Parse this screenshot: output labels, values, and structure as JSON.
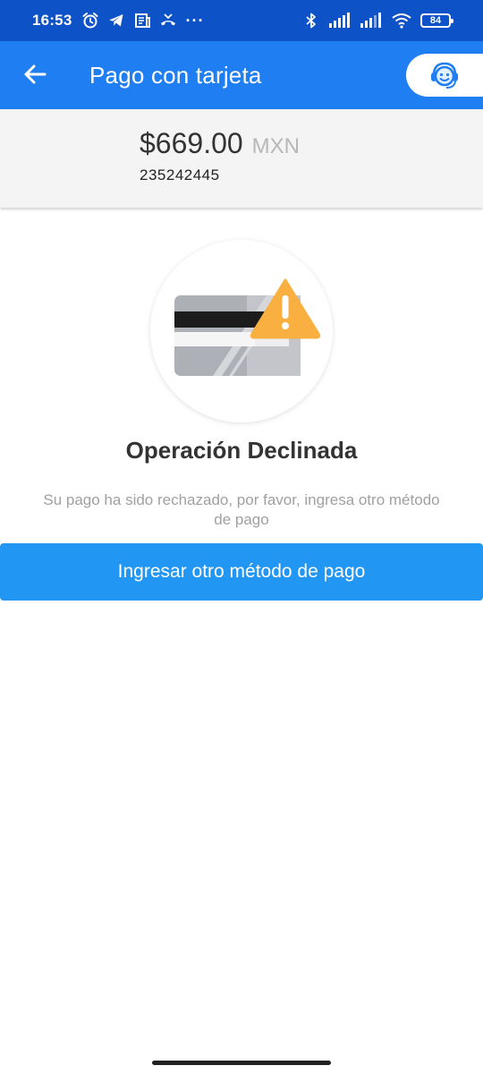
{
  "status_bar": {
    "time": "16:53",
    "more": "···",
    "battery": "84",
    "icons": [
      "alarm-icon",
      "telegram-icon",
      "news-icon",
      "missed-call-icon",
      "bluetooth-icon",
      "signal-icon",
      "signal-icon",
      "wifi-icon",
      "battery-icon"
    ]
  },
  "app_bar": {
    "title": "Pago con tarjeta",
    "back_icon": "arrow-left-icon",
    "support_icon": "support-agent-icon",
    "color": "#1f7ef2"
  },
  "payment": {
    "amount": "$669.00",
    "currency": "MXN",
    "reference": "235242445"
  },
  "result": {
    "illustration": "declined-card-warning-icon",
    "title": "Operación Declinada",
    "message": "Su pago ha sido rechazado, por favor, ingresa otro método de pago",
    "warning_color": "#f9b040"
  },
  "actions": {
    "retry_label": "Ingresar otro método de pago",
    "button_color": "#2196f3"
  }
}
